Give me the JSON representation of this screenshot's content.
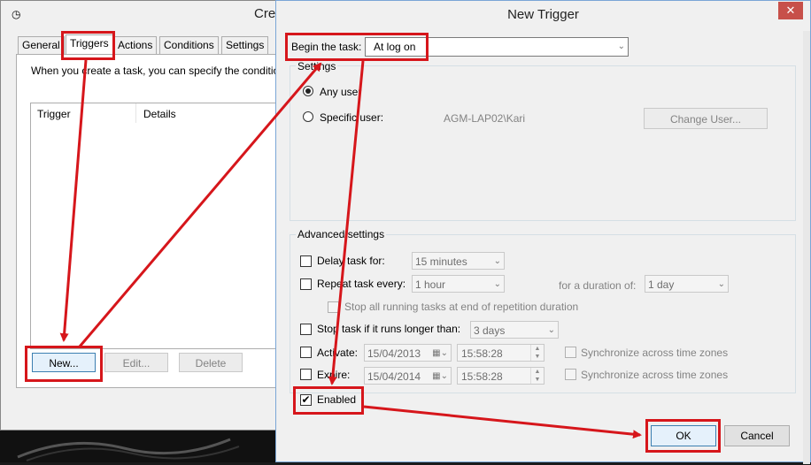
{
  "bg_dialog": {
    "title_partial": "Crea",
    "tabs": [
      "General",
      "Triggers",
      "Actions",
      "Conditions",
      "Settings"
    ],
    "intro_text": "When you create a task, you can specify the conditio",
    "columns": [
      "Trigger",
      "Details"
    ],
    "buttons": {
      "new": "New...",
      "edit": "Edit...",
      "delete": "Delete"
    }
  },
  "new_trigger": {
    "title": "New Trigger",
    "close_glyph": "✕",
    "begin_label": "Begin the task:",
    "begin_value": "At log on",
    "settings_group": "Settings",
    "any_user": "Any user",
    "specific_user": "Specific user:",
    "user_name": "AGM-LAP02\\Kari",
    "change_user": "Change User...",
    "advanced_group": "Advanced settings",
    "delay_label": "Delay task for:",
    "delay_value": "15 minutes",
    "repeat_label": "Repeat task every:",
    "repeat_value": "1 hour",
    "duration_label": "for a duration of:",
    "duration_value": "1 day",
    "stop_all": "Stop all running tasks at end of repetition duration",
    "stop_longer": "Stop task if it runs longer than:",
    "stop_longer_value": "3 days",
    "activate_label": "Activate:",
    "activate_date": "15/04/2013",
    "activate_time": "15:58:28",
    "expire_label": "Expire:",
    "expire_date": "15/04/2014",
    "expire_time": "15:58:28",
    "sync_tz": "Synchronize across time zones",
    "enabled_label": "Enabled",
    "enabled_checked": true,
    "ok": "OK",
    "cancel": "Cancel"
  },
  "annotation_color": "#d6161b"
}
